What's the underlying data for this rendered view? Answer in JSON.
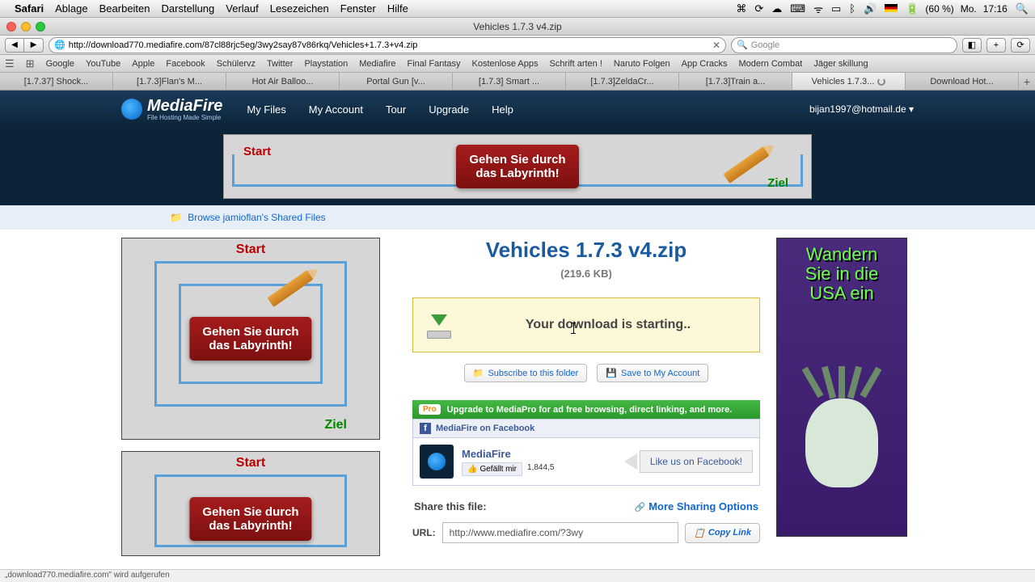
{
  "mac_menu": {
    "app": "Safari",
    "items": [
      "Ablage",
      "Bearbeiten",
      "Darstellung",
      "Verlauf",
      "Lesezeichen",
      "Fenster",
      "Hilfe"
    ],
    "battery": "(60 %)",
    "day": "Mo.",
    "time": "17:16"
  },
  "window": {
    "title": "Vehicles 1.7.3 v4.zip"
  },
  "toolbar": {
    "url": "http://download770.mediafire.com/87cl88rjc5eg/3wy2say87v86rkq/Vehicles+1.7.3+v4.zip",
    "search_placeholder": "Google"
  },
  "bookmarks": [
    "Google",
    "YouTube",
    "Apple",
    "Facebook",
    "Schülervz",
    "Twitter",
    "Playstation",
    "Mediafire",
    "Final Fantasy",
    "Kostenlose Apps",
    "Schrift arten !",
    "Naruto Folgen",
    "App Cracks",
    "Modern Combat",
    "Jäger skillung"
  ],
  "tabs": [
    "[1.7.37] Shock...",
    "[1.7.3]Flan's M...",
    "Hot Air Balloo...",
    "Portal Gun [v...",
    "[1.7.3] Smart ...",
    "[1.7.3]ZeldaCr...",
    "[1.7.3]Train a...",
    "Vehicles 1.7.3...",
    "Download Hot..."
  ],
  "mf": {
    "logo": "MediaFire",
    "logo_sub": "File Hosting Made Simple",
    "nav": [
      "My Files",
      "My Account",
      "Tour",
      "Upgrade",
      "Help"
    ],
    "user": "bijan1997@hotmail.de ▾"
  },
  "ad": {
    "start": "Start",
    "ziel": "Ziel",
    "redbox": "Gehen Sie durch\ndas Labyrinth!"
  },
  "browse": {
    "text": "Browse jamioflan's Shared Files"
  },
  "file": {
    "title": "Vehicles 1.7.3 v4.zip",
    "size": "(219.6 KB)"
  },
  "download": {
    "text": "Your download is starting.."
  },
  "actions": {
    "subscribe": "Subscribe to this folder",
    "save": "Save to My Account"
  },
  "pro": {
    "badge": "Pro",
    "text": "Upgrade to MediaPro for ad free browsing, direct linking, and more."
  },
  "fb": {
    "header": "MediaFire on Facebook",
    "name": "MediaFire",
    "like": "Gefällt mir",
    "count": "1,844,5",
    "cta": "Like us on Facebook!"
  },
  "share": {
    "title": "Share this file:",
    "more": "More Sharing Options",
    "url_label": "URL:",
    "url_value": "http://www.mediafire.com/?3wy",
    "copy": "Copy Link"
  },
  "ad_right": {
    "line1": "Wandern",
    "line2": "Sie in die",
    "line3": "USA ein"
  },
  "status": {
    "text": "„download770.mediafire.com\" wird aufgerufen"
  }
}
